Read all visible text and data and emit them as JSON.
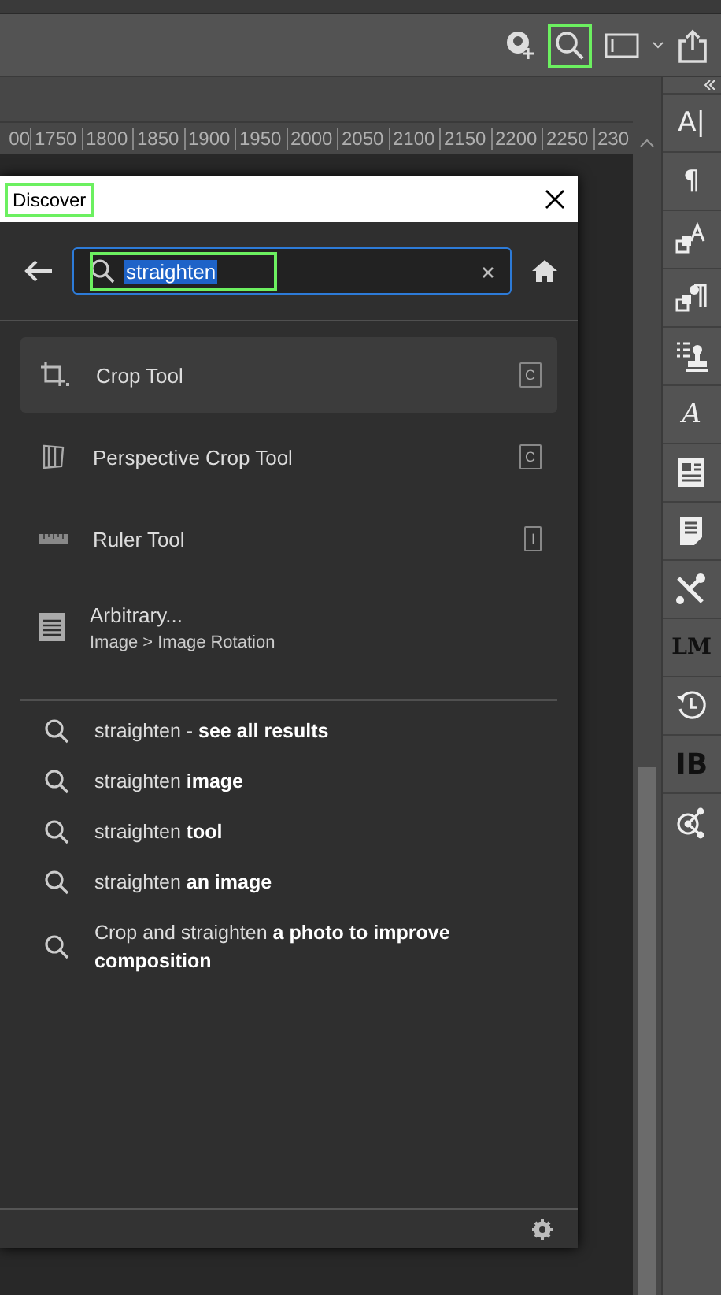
{
  "toolbar": {
    "search_highlighted": true
  },
  "ruler": {
    "labels": [
      "00",
      "1750",
      "1800",
      "1850",
      "1900",
      "1950",
      "2000",
      "2050",
      "2100",
      "2150",
      "2200",
      "2250",
      "230"
    ]
  },
  "panels": [
    {
      "kind": "glyph",
      "label": "A|"
    },
    {
      "kind": "glyph",
      "label": "¶"
    },
    {
      "kind": "char-styles"
    },
    {
      "kind": "para-styles"
    },
    {
      "kind": "stamp"
    },
    {
      "kind": "script",
      "label": "A"
    },
    {
      "kind": "layout"
    },
    {
      "kind": "note"
    },
    {
      "kind": "tools"
    },
    {
      "kind": "stack",
      "label": "LM"
    },
    {
      "kind": "history"
    },
    {
      "kind": "bold",
      "label": "IB"
    },
    {
      "kind": "share"
    }
  ],
  "dialog": {
    "title": "Discover",
    "title_highlighted": true,
    "search": {
      "value": "straighten",
      "highlighted": true
    },
    "results": [
      {
        "kind": "crop",
        "label": "Crop Tool",
        "shortcut": "C",
        "selected": true
      },
      {
        "kind": "perspective",
        "label": "Perspective Crop Tool",
        "shortcut": "C",
        "selected": false
      },
      {
        "kind": "ruler",
        "label": "Ruler Tool",
        "shortcut": "I",
        "selected": false
      },
      {
        "kind": "menu",
        "label": "Arbitrary...",
        "path": "Image > Image Rotation",
        "selected": false
      }
    ],
    "suggestions": [
      "straighten - **see all results**",
      "straighten **image**",
      "straighten **tool**",
      "straighten **an image**",
      "Crop and straighten **a photo to improve composition**"
    ]
  }
}
